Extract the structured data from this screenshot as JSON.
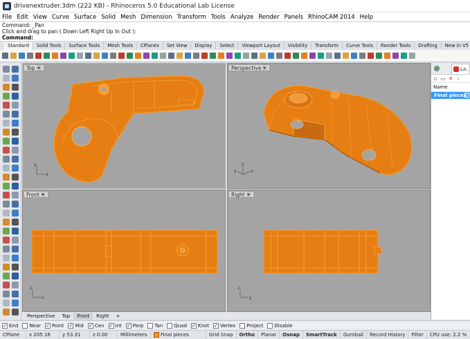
{
  "window": {
    "title": "drivenextruder.3dm (222 KB) - Rhinoceros 5.0 Educational Lab License"
  },
  "menu": {
    "items": [
      "File",
      "Edit",
      "View",
      "Curve",
      "Surface",
      "Solid",
      "Mesh",
      "Dimension",
      "Transform",
      "Tools",
      "Analyze",
      "Render",
      "Panels",
      "RhinoCAM 2014",
      "Help"
    ]
  },
  "command": {
    "history_1": "Command: _Pan",
    "history_2": "Click and drag to pan ( Down  Left  Right  Up  In  Out ):",
    "prompt": "Command:",
    "value": ""
  },
  "toolbar_tabs": [
    "Standard",
    "Solid Tools",
    "Surface Tools",
    "Mesh Tools",
    "CPlanes",
    "Set View",
    "Display",
    "Select",
    "Viewport Layout",
    "Visibility",
    "Transform",
    "Curve Tools",
    "Render Tools",
    "Drafting",
    "New in V5",
    "RhinoThemes"
  ],
  "toolbar_icons": [
    "new-icon",
    "open-icon",
    "save-icon",
    "print-icon",
    "import-icon",
    "cut-icon",
    "copy-icon",
    "paste-icon",
    "undo-icon",
    "redo-icon",
    "pan-icon",
    "rotate-icon",
    "zoom-icon",
    "zoom-window-icon",
    "zoom-extents-icon",
    "zoom-selected-icon",
    "four-view-icon",
    "wireframe-icon",
    "shaded-icon",
    "rendered-icon",
    "ghosted-icon",
    "xray-icon",
    "select-icon",
    "point-icon",
    "curve-icon",
    "surface-icon",
    "solid-icon",
    "mesh-icon",
    "transform-icon",
    "layer-icon",
    "properties-icon",
    "light-icon",
    "material-icon",
    "render-icon",
    "help-icon",
    "options-icon",
    "color-icon",
    "dims-icon",
    "analyze-icon",
    "snap-icon",
    "grid-icon",
    "ortho-icon",
    "history-icon",
    "gumball-icon",
    "record-icon",
    "extra-icon",
    "extra2-icon",
    "extra3-icon",
    "extra4-icon",
    "extra5-icon"
  ],
  "viewports": {
    "top": "Top",
    "perspective": "Perspective",
    "front": "Front",
    "right": "Right"
  },
  "axis": {
    "x": "x",
    "y": "y",
    "z": "z"
  },
  "viewport_tabs": [
    "Perspective",
    "Top",
    "Front",
    "Right"
  ],
  "viewport_tab_add": "+",
  "right_panel": {
    "tab_layers": "La...",
    "column_name": "Name",
    "layer_name": "Final pieces",
    "layer_check": "✓"
  },
  "osnaps": [
    {
      "label": "End",
      "checked": true
    },
    {
      "label": "Near",
      "checked": false
    },
    {
      "label": "Point",
      "checked": true
    },
    {
      "label": "Mid",
      "checked": true
    },
    {
      "label": "Cen",
      "checked": true
    },
    {
      "label": "Int",
      "checked": true
    },
    {
      "label": "Perp",
      "checked": true
    },
    {
      "label": "Tan",
      "checked": false
    },
    {
      "label": "Quad",
      "checked": false
    },
    {
      "label": "Knot",
      "checked": true
    },
    {
      "label": "Vertex",
      "checked": true
    },
    {
      "label": "Project",
      "checked": false
    },
    {
      "label": "Disable",
      "checked": false
    }
  ],
  "status": {
    "cplane": "CPlane",
    "x": "x 205.16",
    "y": "y 53.31",
    "z": "z 0.00",
    "units": "Millimeters",
    "layer": "Final pieces",
    "grid_snap": "Grid Snap",
    "ortho": "Ortho",
    "planar": "Planar",
    "osnap": "Osnap",
    "smarttrack": "SmartTrack",
    "gumball": "Gumball",
    "record_history": "Record History",
    "filter": "Filter",
    "cpu": "CPU use: 2.2 %"
  },
  "colors": {
    "part_fill": "#e67e14",
    "part_edge": "#ff8c00",
    "viewport_bg": "#a4a4a4",
    "layer_highlight": "#3399ff"
  }
}
